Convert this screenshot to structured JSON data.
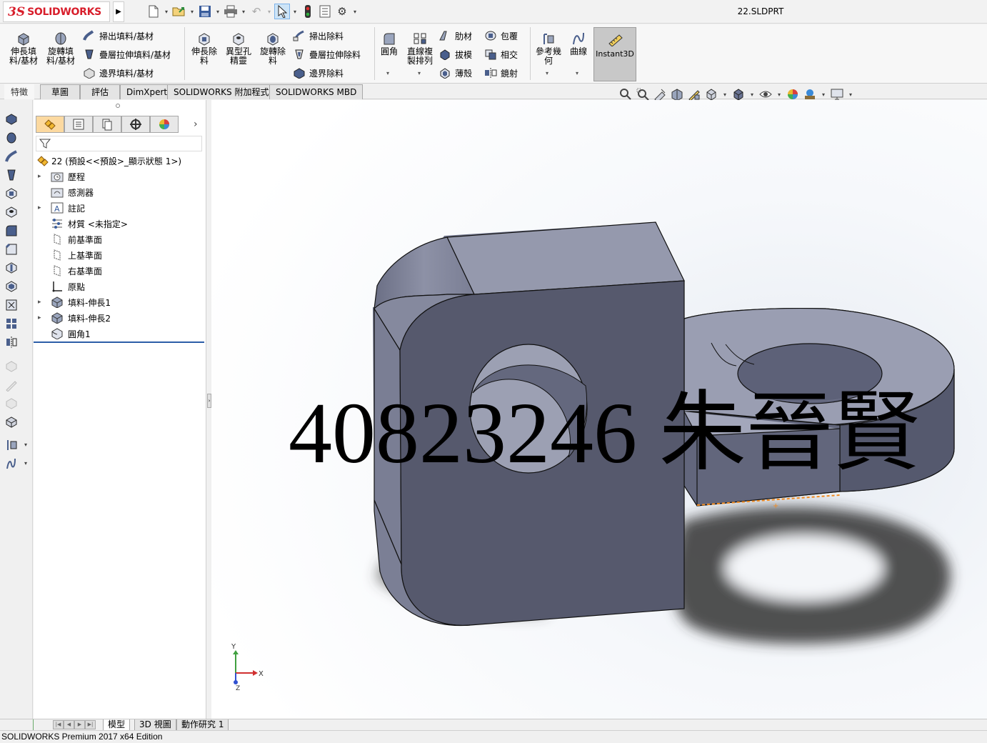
{
  "app": {
    "brand_ds": "3S",
    "brand_name": "SOLIDWORKS",
    "document_title": "22.SLDPRT"
  },
  "quick_access": [
    "new-icon",
    "open-icon",
    "save-icon",
    "print-icon",
    "undo-icon",
    "select-icon",
    "rebuild-icon",
    "file-properties-icon",
    "options-icon"
  ],
  "ribbon": {
    "boss_extrude": "伸長填\n料/基材",
    "revolve_boss": "旋轉填\n料/基材",
    "swept_boss": "掃出填料/基材",
    "lofted_boss": "疊層拉伸填料/基材",
    "boundary_boss": "邊界填料/基材",
    "extruded_cut": "伸長除\n料",
    "hole_wizard": "異型孔\n精靈",
    "revolved_cut": "旋轉除\n料",
    "swept_cut": "掃出除料",
    "lofted_cut": "疊層拉伸除料",
    "boundary_cut": "邊界除料",
    "fillet": "圓角",
    "linear_pattern": "直線複\n製排列",
    "rib": "肋材",
    "draft": "拔模",
    "shell": "薄殼",
    "wrap": "包覆",
    "intersect": "相交",
    "mirror": "鏡射",
    "reference_geometry": "參考幾\n何",
    "curves": "曲線",
    "instant3d": "Instant3D"
  },
  "command_tabs": [
    "特徵",
    "草圖",
    "評估",
    "DimXpert",
    "SOLIDWORKS 附加程式",
    "SOLIDWORKS MBD"
  ],
  "active_command_tab": "特徵",
  "feature_tree": {
    "root": "22  (預設<<預設>_顯示狀態 1>)",
    "items": [
      {
        "label": "歷程",
        "expandable": true,
        "icon": "history-folder-icon"
      },
      {
        "label": "感測器",
        "expandable": false,
        "icon": "sensors-folder-icon"
      },
      {
        "label": "註記",
        "expandable": true,
        "icon": "annotations-icon"
      },
      {
        "label": "材質 <未指定>",
        "expandable": false,
        "icon": "material-icon"
      },
      {
        "label": "前基準面",
        "expandable": false,
        "icon": "plane-icon"
      },
      {
        "label": "上基準面",
        "expandable": false,
        "icon": "plane-icon"
      },
      {
        "label": "右基準面",
        "expandable": false,
        "icon": "plane-icon"
      },
      {
        "label": "原點",
        "expandable": false,
        "icon": "origin-icon"
      },
      {
        "label": "填料-伸長1",
        "expandable": true,
        "icon": "extrude-feature-icon"
      },
      {
        "label": "填料-伸長2",
        "expandable": true,
        "icon": "extrude-feature-icon"
      },
      {
        "label": "圓角1",
        "expandable": false,
        "icon": "fillet-feature-icon"
      }
    ]
  },
  "viewport": {
    "overlay_text": "40823246 朱晉賢",
    "triad_x": "X",
    "triad_y": "Y",
    "triad_z": "Z",
    "model_color": "#8a8ea0",
    "background_top": "#ffffff",
    "background_bottom": "#cfd6e0"
  },
  "bottom_tabs": [
    "模型",
    "3D 視圖",
    "動作研究 1"
  ],
  "active_bottom_tab": "模型",
  "status": "SOLIDWORKS Premium 2017 x64 Edition"
}
